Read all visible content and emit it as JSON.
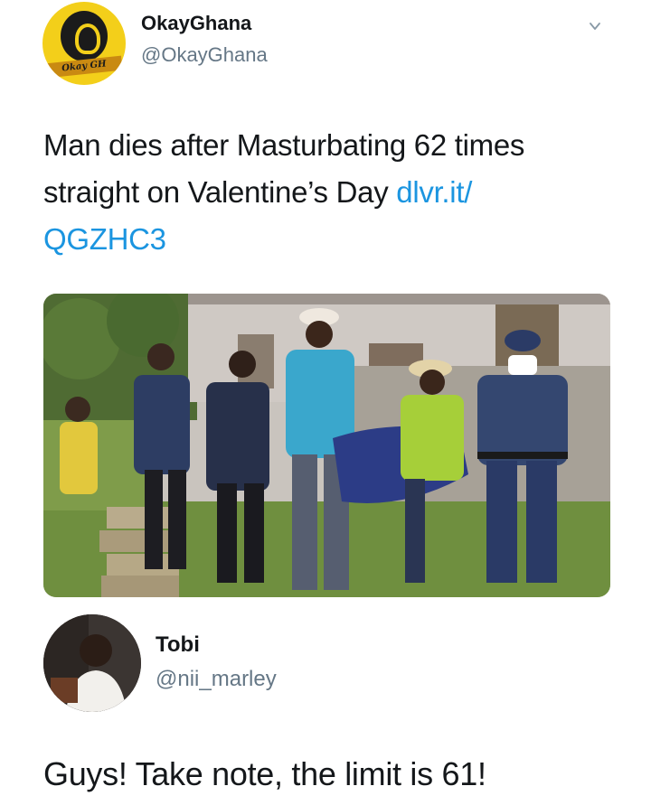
{
  "tweet": {
    "display_name": "OkayGhana",
    "handle": "@OkayGhana",
    "avatar_label": "Okay GH",
    "text": "Man dies after Masturbating 62 times straight on Valentine’s Day ",
    "link": "dlvr.it/QGZHC3",
    "link_line1": "dlvr.it/",
    "link_line2": "QGZHC3",
    "menu_icon": "chevron-down-icon",
    "media_alt": "photo"
  },
  "reply": {
    "display_name": "Tobi",
    "handle": "@nii_marley",
    "text": "Guys! Take note, the limit is 61!"
  },
  "colors": {
    "text": "#14171a",
    "secondary": "#657786",
    "link": "#1b95e0",
    "avatar_bg": "#f3cf1a"
  }
}
